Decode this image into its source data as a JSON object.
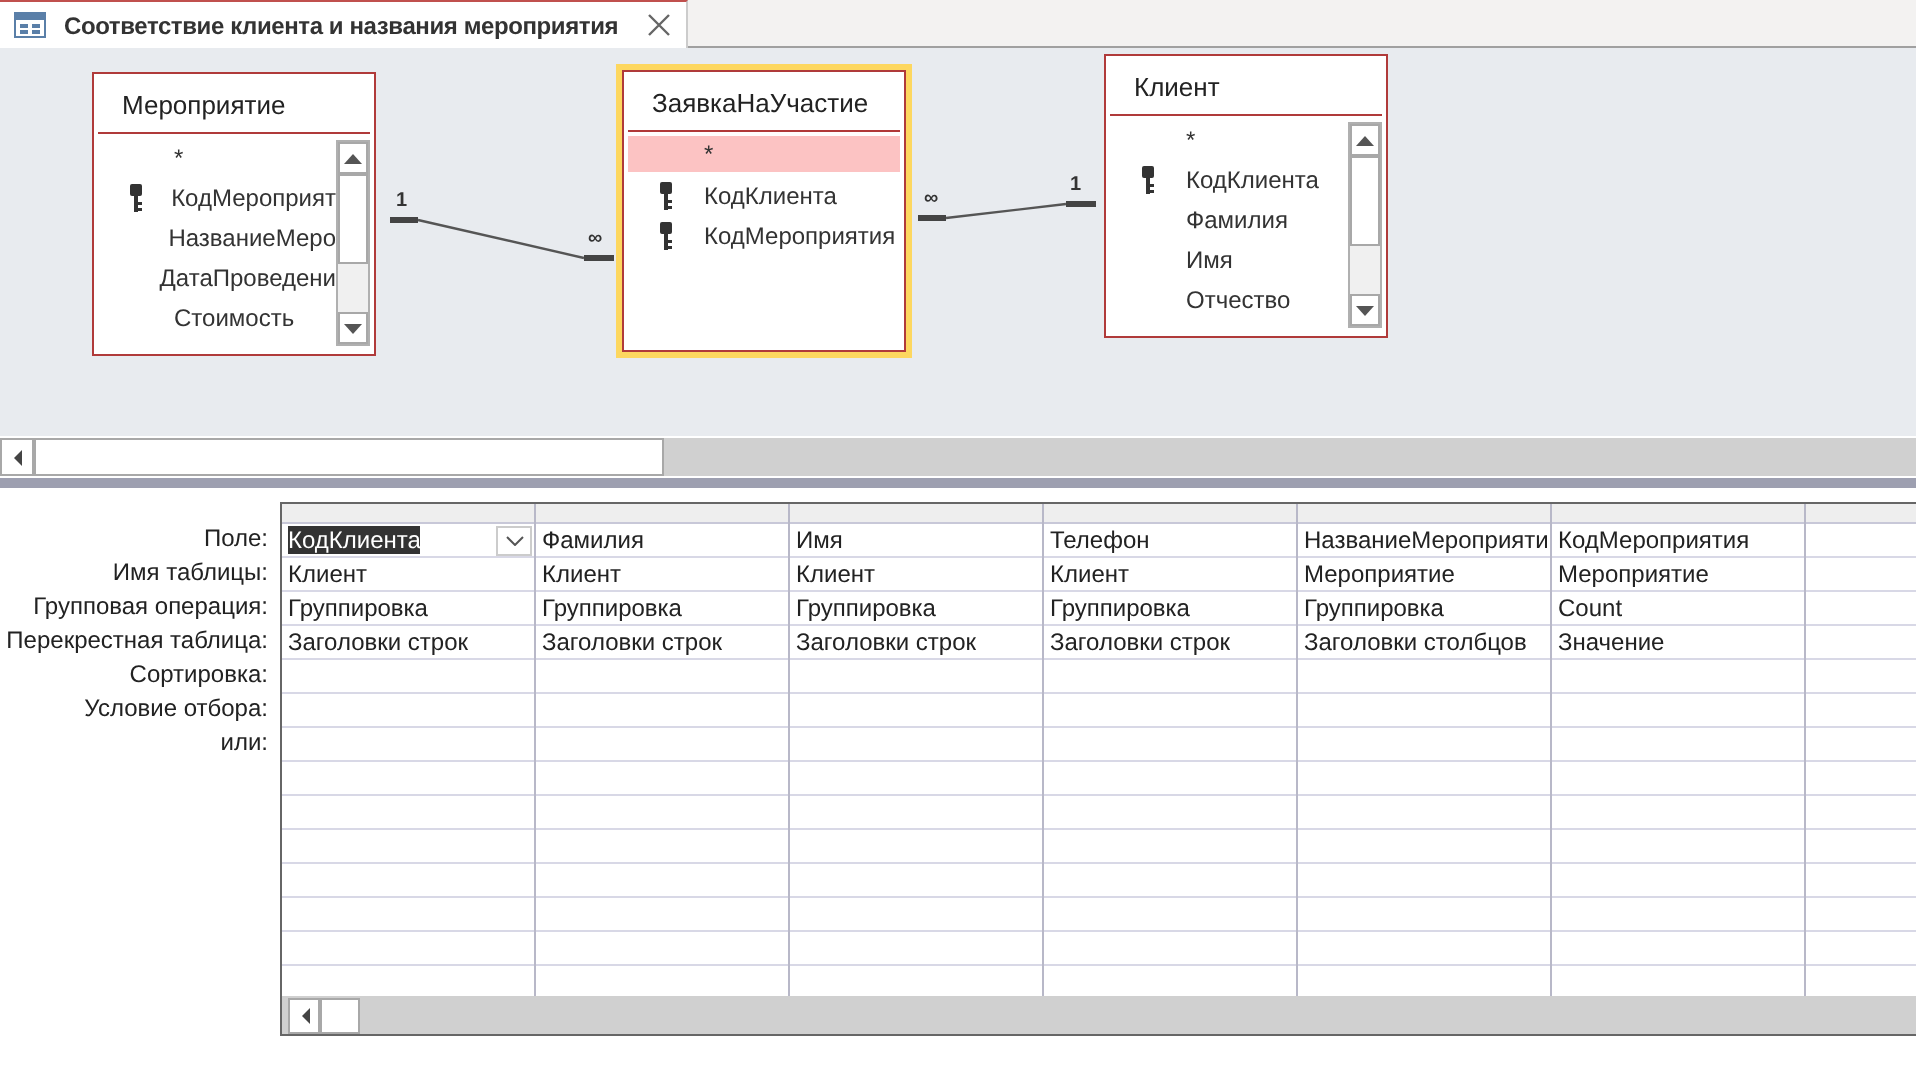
{
  "window": {
    "title": "Соответствие клиента и названия мероприятия"
  },
  "tables": [
    {
      "title": "Мероприятие",
      "selected": false,
      "scrollbar": true,
      "fields": [
        {
          "name": "*",
          "key": false,
          "selected": false
        },
        {
          "name": "КодМероприят",
          "key": true,
          "selected": false
        },
        {
          "name": "НазваниеМеро",
          "key": false,
          "selected": false
        },
        {
          "name": "ДатаПроведени",
          "key": false,
          "selected": false
        },
        {
          "name": "Стоимость",
          "key": false,
          "selected": false
        }
      ]
    },
    {
      "title": "ЗаявкаНаУчастие",
      "selected": true,
      "scrollbar": false,
      "fields": [
        {
          "name": "*",
          "key": false,
          "selected": true
        },
        {
          "name": "КодКлиента",
          "key": true,
          "selected": false
        },
        {
          "name": "КодМероприятия",
          "key": true,
          "selected": false
        }
      ]
    },
    {
      "title": "Клиент",
      "selected": false,
      "scrollbar": true,
      "fields": [
        {
          "name": "*",
          "key": false,
          "selected": false
        },
        {
          "name": "КодКлиента",
          "key": true,
          "selected": false
        },
        {
          "name": "Фамилия",
          "key": false,
          "selected": false
        },
        {
          "name": "Имя",
          "key": false,
          "selected": false
        },
        {
          "name": "Отчество",
          "key": false,
          "selected": false
        }
      ]
    }
  ],
  "relationships": [
    {
      "one_label": "1",
      "many_label": "∞"
    },
    {
      "one_label": "1",
      "many_label": "∞"
    }
  ],
  "query_grid": {
    "row_labels": [
      "Поле:",
      "Имя таблицы:",
      "Групповая операция:",
      "Перекрестная таблица:",
      "Сортировка:",
      "Условие отбора:",
      "или:"
    ],
    "columns": [
      {
        "selected": true,
        "cells": [
          "КодКлиента",
          "Клиент",
          "Группировка",
          "Заголовки строк"
        ]
      },
      {
        "selected": false,
        "cells": [
          "Фамилия",
          "Клиент",
          "Группировка",
          "Заголовки строк"
        ]
      },
      {
        "selected": false,
        "cells": [
          "Имя",
          "Клиент",
          "Группировка",
          "Заголовки строк"
        ]
      },
      {
        "selected": false,
        "cells": [
          "Телефон",
          "Клиент",
          "Группировка",
          "Заголовки строк"
        ]
      },
      {
        "selected": false,
        "cells": [
          "НазваниеМероприяти",
          "Мероприятие",
          "Группировка",
          "Заголовки столбцов"
        ]
      },
      {
        "selected": false,
        "cells": [
          "КодМероприятия",
          "Мероприятие",
          "Count",
          "Значение"
        ]
      }
    ]
  }
}
